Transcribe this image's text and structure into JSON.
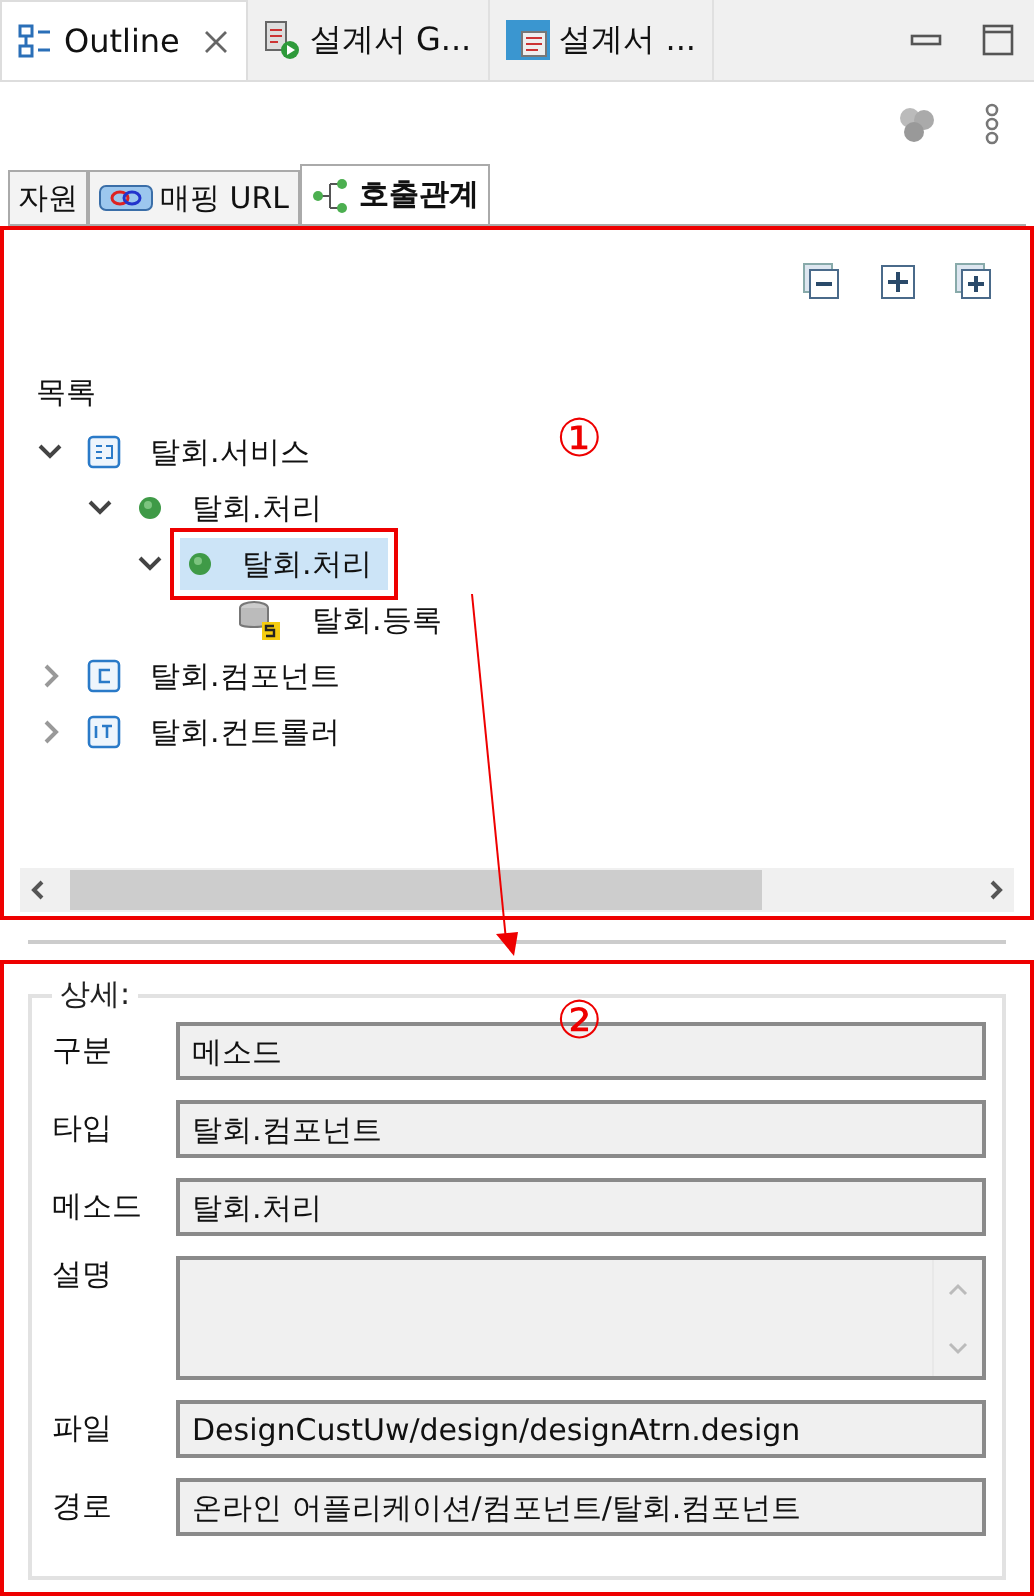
{
  "view_tabs": [
    {
      "label": "Outline",
      "kind": "outline",
      "selected": true,
      "closable": true
    },
    {
      "label": "설계서 G...",
      "kind": "run-doc",
      "selected": false,
      "closable": false
    },
    {
      "label": "설계서 ...",
      "kind": "b-doc",
      "selected": false,
      "closable": false
    }
  ],
  "inner_tabs": [
    {
      "label": "자원",
      "kind": "plain",
      "selected": false
    },
    {
      "label": "매핑 URL",
      "kind": "link",
      "selected": false
    },
    {
      "label": "호출관계",
      "kind": "graph",
      "selected": true
    }
  ],
  "tree": {
    "label": "목록",
    "items": [
      {
        "label": "탈회.서비스",
        "kind": "service",
        "expanded": true,
        "selected": false,
        "children": [
          {
            "label": "탈회.처리",
            "kind": "method",
            "expanded": true,
            "selected": false,
            "children": [
              {
                "label": "탈회.처리",
                "kind": "method",
                "expanded": true,
                "selected": true,
                "children": [
                  {
                    "label": "탈회.등록",
                    "kind": "sql",
                    "selected": false
                  }
                ]
              }
            ]
          }
        ]
      },
      {
        "label": "탈회.컴포넌트",
        "kind": "component",
        "expanded": false,
        "selected": false
      },
      {
        "label": "탈회.컨트롤러",
        "kind": "controller",
        "expanded": false,
        "selected": false
      }
    ]
  },
  "details": {
    "title": "상세:",
    "fields": [
      {
        "label": "구분",
        "kind": "line",
        "value": "메소드"
      },
      {
        "label": "타입",
        "kind": "line",
        "value": "탈회.컴포넌트"
      },
      {
        "label": "메소드",
        "kind": "line",
        "value": "탈회.처리"
      },
      {
        "label": "설명",
        "kind": "area"
      },
      {
        "label": "파일",
        "kind": "line",
        "value": "DesignCustUw/design/designAtrn.design"
      },
      {
        "label": "경로",
        "kind": "line",
        "value": "온라인 어플리케이션/컴포넌트/탈회.컴포넌트"
      }
    ]
  },
  "annotations": [
    "①",
    "②"
  ]
}
